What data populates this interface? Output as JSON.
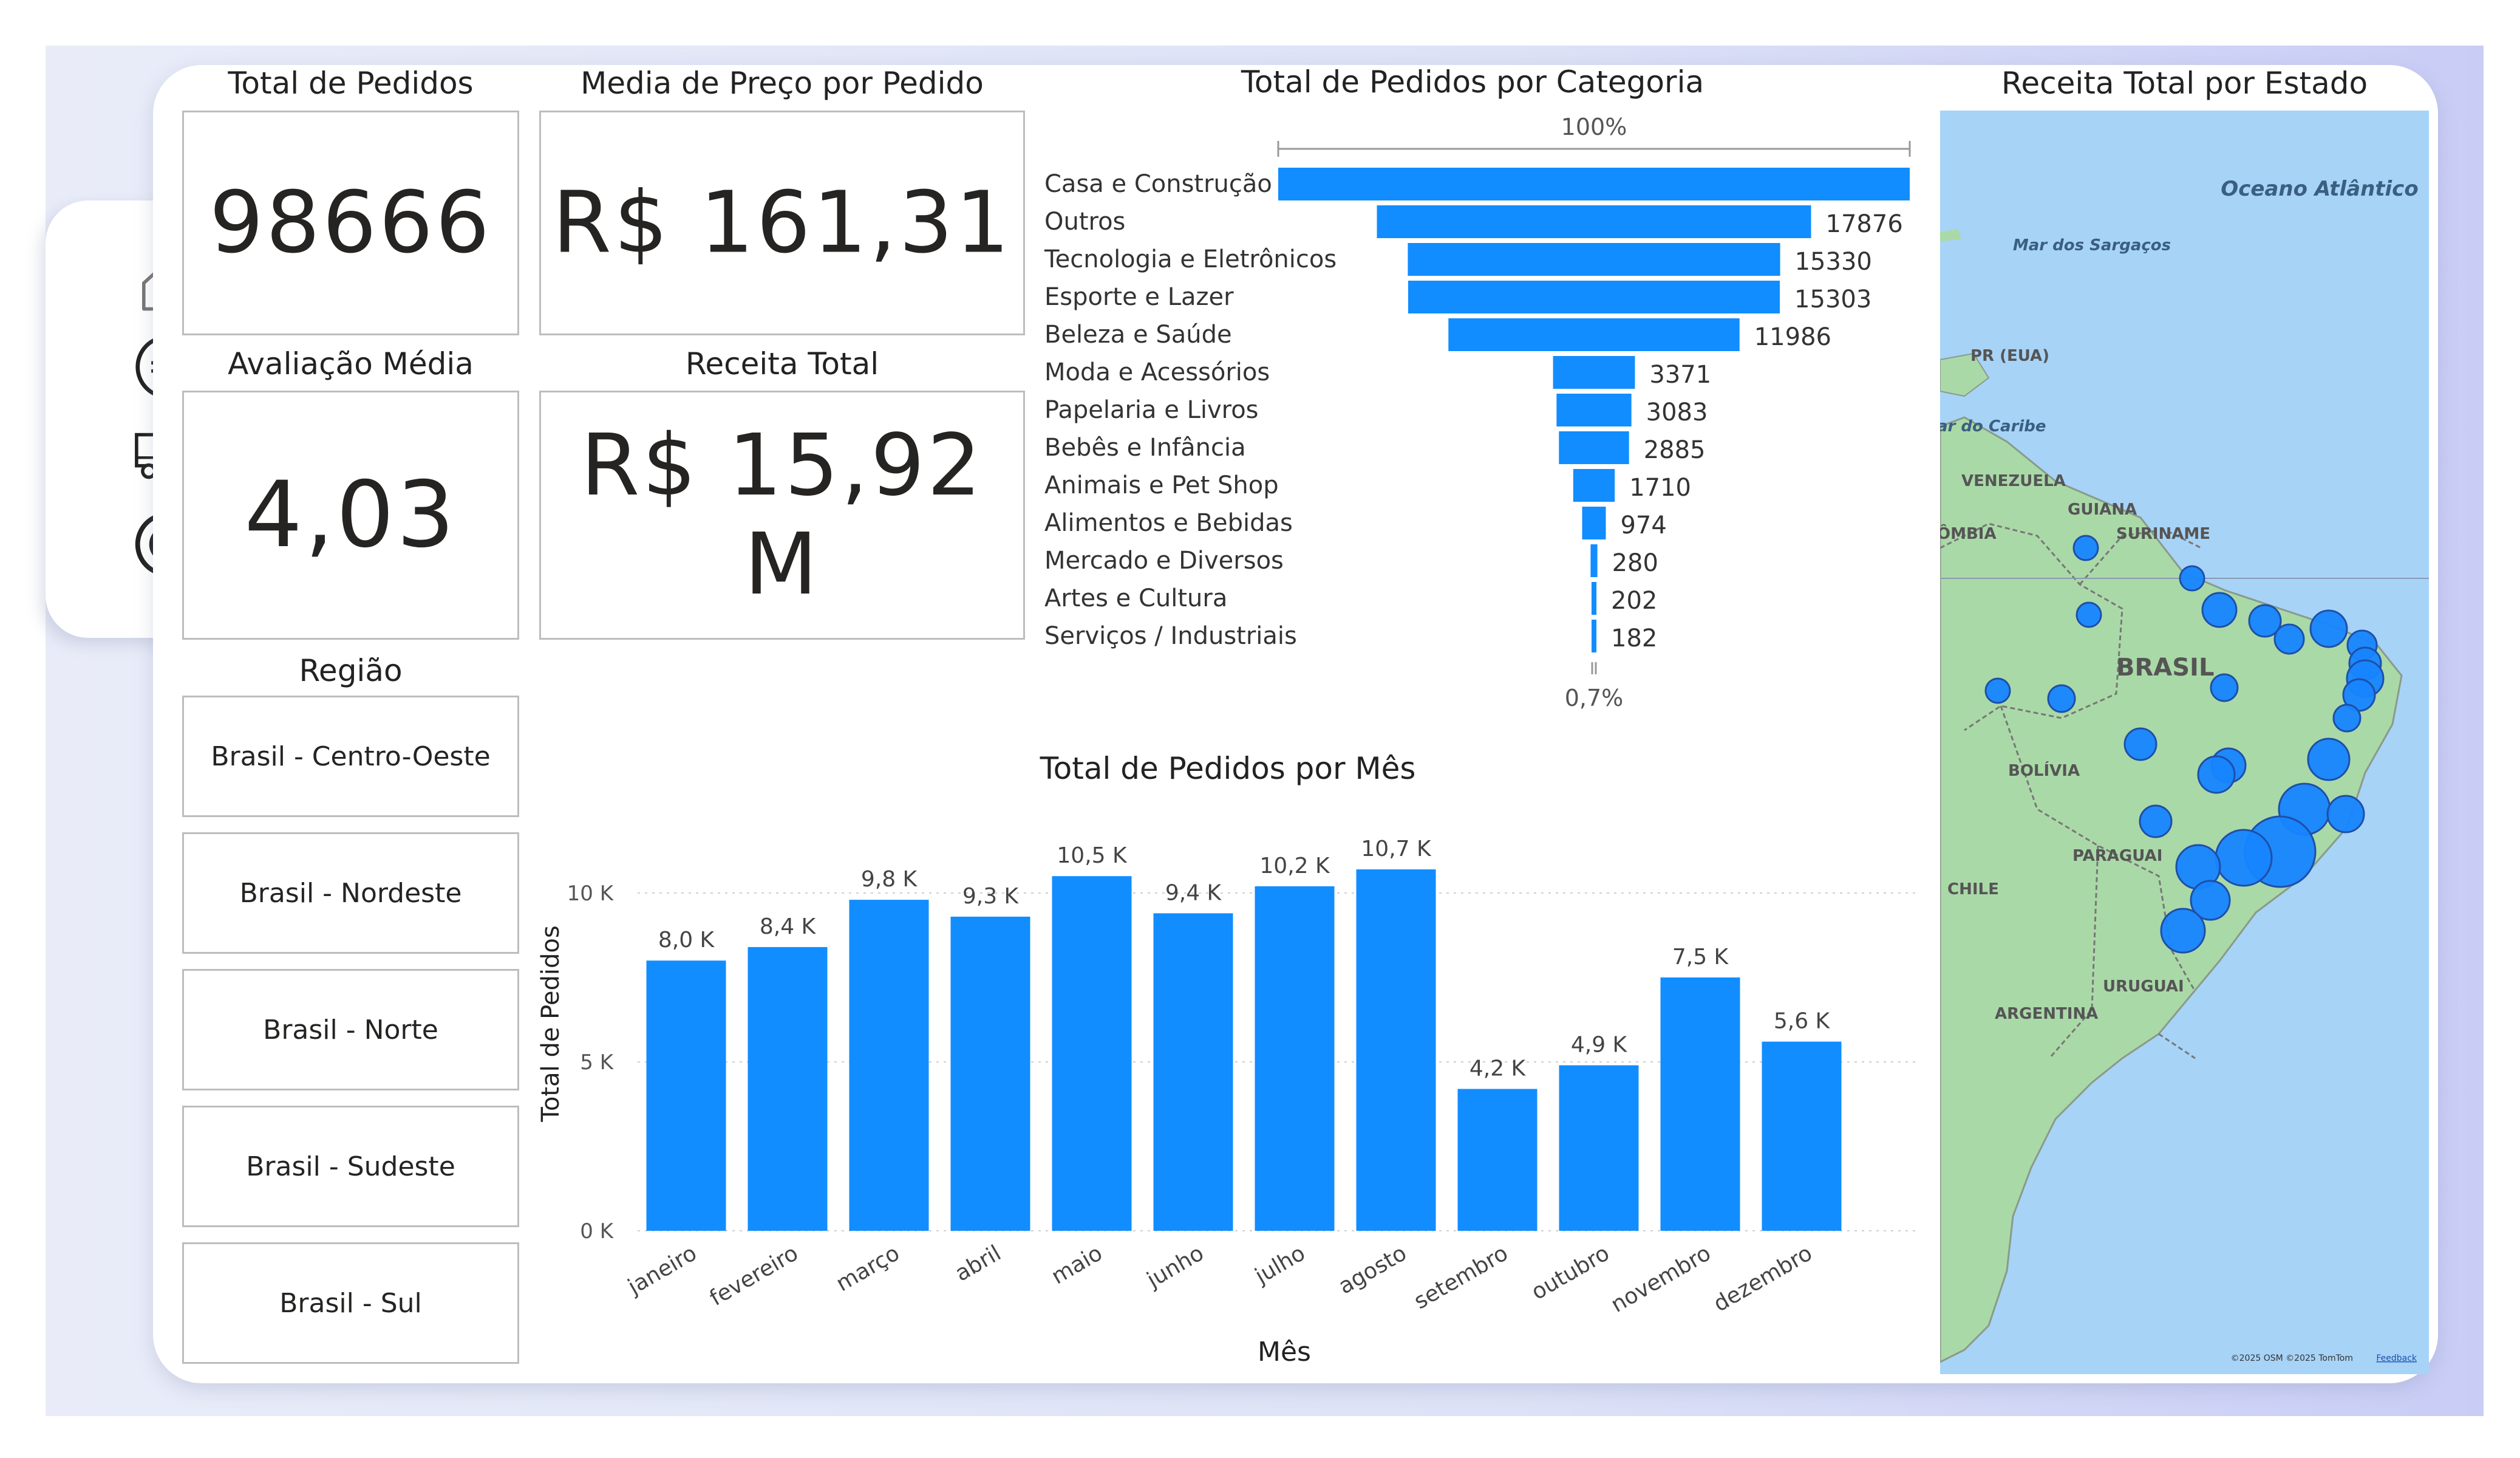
{
  "kpis": {
    "total_pedidos": {
      "title": "Total de Pedidos",
      "value": "98666"
    },
    "media_preco": {
      "title": "Media de Preço por Pedido",
      "value": "R$ 161,31"
    },
    "avaliacao": {
      "title": "Avaliação Média",
      "value": "4,03"
    },
    "receita": {
      "title": "Receita Total",
      "value": "R$ 15,92 M"
    }
  },
  "regiao": {
    "title": "Região",
    "items": [
      "Brasil - Centro-Oeste",
      "Brasil - Nordeste",
      "Brasil - Norte",
      "Brasil - Sudeste",
      "Brasil - Sul"
    ]
  },
  "nav": {
    "icons": [
      "home-icon",
      "euro-icon",
      "truck-icon",
      "target-icon"
    ]
  },
  "colors": {
    "accent": "#118dff",
    "border": "#bdbdbd",
    "map_water": "#a7d3f7",
    "map_land": "#aad9a8"
  },
  "chart_data": [
    {
      "type": "bar",
      "title": "Total de Pedidos por Categoria",
      "top_label": "100%",
      "bottom_label": "0,7%",
      "categories": [
        "Casa e Construção",
        "Outros",
        "Tecnologia e Eletrônicos",
        "Esporte e Lazer",
        "Beleza e Saúde",
        "Moda e Acessórios",
        "Papelaria e Livros",
        "Bebês e Infância",
        "Animais e Pet Shop",
        "Alimentos e Bebidas",
        "Mercado e Diversos",
        "Artes e Cultura",
        "Serviços / Industriais"
      ],
      "values": [
        26000,
        17876,
        15330,
        15303,
        11986,
        3371,
        3083,
        2885,
        1710,
        974,
        280,
        202,
        182
      ],
      "value_labels": [
        "",
        "17876",
        "15330",
        "15303",
        "11986",
        "3371",
        "3083",
        "2885",
        "1710",
        "974",
        "280",
        "202",
        "182"
      ]
    },
    {
      "type": "bar",
      "title": "Total de Pedidos por Mês",
      "xlabel": "Mês",
      "ylabel": "Total de Pedidos",
      "categories": [
        "janeiro",
        "fevereiro",
        "março",
        "abril",
        "maio",
        "junho",
        "julho",
        "agosto",
        "setembro",
        "outubro",
        "novembro",
        "dezembro"
      ],
      "values": [
        8000,
        8400,
        9800,
        9300,
        10500,
        9400,
        10200,
        10700,
        4200,
        4900,
        7500,
        5600
      ],
      "value_labels": [
        "8,0 K",
        "8,4 K",
        "9,8 K",
        "9,3 K",
        "10,5 K",
        "9,4 K",
        "10,2 K",
        "10,7 K",
        "4,2 K",
        "4,9 K",
        "7,5 K",
        "5,6 K"
      ],
      "yticks": [
        {
          "v": 0,
          "label": "0 K"
        },
        {
          "v": 5000,
          "label": "5 K"
        },
        {
          "v": 10000,
          "label": "10 K"
        }
      ],
      "ylim": [
        0,
        12000
      ],
      "grid": true
    },
    {
      "type": "scatter",
      "title": "Receita Total por Estado",
      "map_labels": [
        "Oceano Atlântico",
        "Mar dos Sargaços",
        "PR (EUA)",
        "ar do Caribe",
        "VENEZUELA",
        "GUIANA",
        "SURINAME",
        "ÔMBIA",
        "BRASIL",
        "BOLÍVIA",
        "PARAGUAI",
        "CHILE",
        "URUGUAI",
        "ARGENTINA"
      ],
      "attribution": "©2025 OSM ©2025 TomTom",
      "feedback": "Feedback"
    }
  ]
}
